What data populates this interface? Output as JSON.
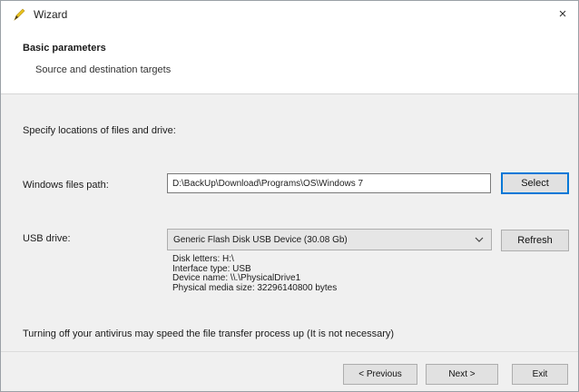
{
  "window": {
    "title": "Wizard",
    "close_glyph": "×"
  },
  "header": {
    "title": "Basic parameters",
    "subtitle": "Source and destination targets"
  },
  "main": {
    "instruction": "Specify locations of files and drive:",
    "windows_path": {
      "label": "Windows files path:",
      "value": "D:\\BackUp\\Download\\Programs\\OS\\Windows 7",
      "select_label": "Select"
    },
    "usb": {
      "label": "USB drive:",
      "selected": "Generic Flash Disk USB Device (30.08 Gb)",
      "refresh_label": "Refresh",
      "info": [
        "Disk letters: H:\\",
        "Interface type: USB",
        "Device name: \\\\.\\PhysicalDrive1",
        "Physical media size: 32296140800 bytes"
      ]
    },
    "note": "Turning off your antivirus may speed the file transfer process up (It is not necessary)"
  },
  "footer": {
    "previous_label": "< Previous",
    "next_label": "Next >",
    "exit_label": "Exit"
  },
  "colors": {
    "accent": "#0078d7",
    "pencil": "#e8c21a"
  }
}
